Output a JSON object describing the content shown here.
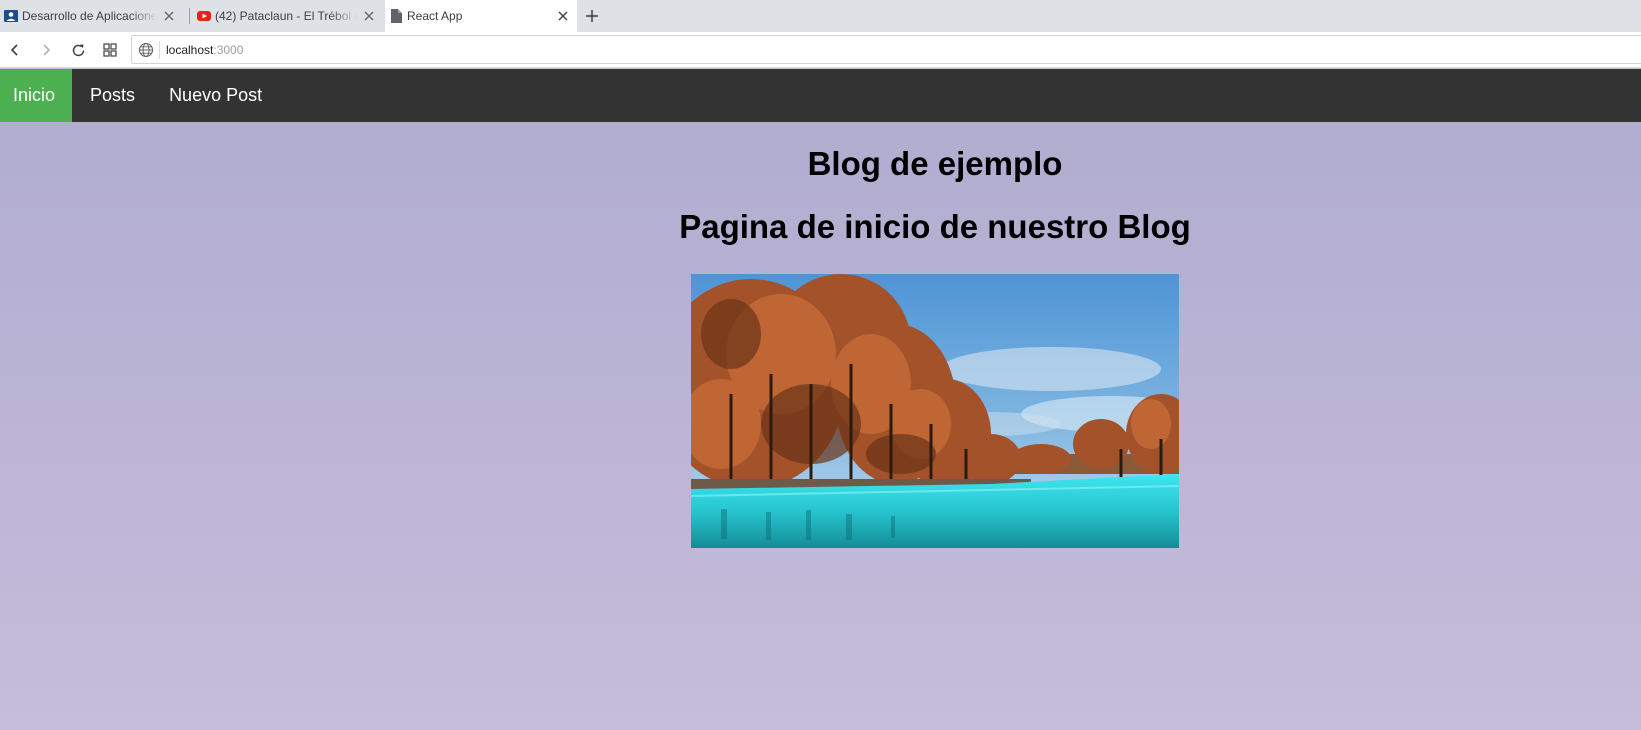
{
  "browser": {
    "tabs": [
      {
        "title": "Desarrollo de Aplicaciones",
        "icon": "contact-card-icon",
        "active": false
      },
      {
        "title": "(42) Pataclaun - El Trébol de",
        "icon": "youtube-icon",
        "active": false
      },
      {
        "title": "React App",
        "icon": "document-icon",
        "active": true
      }
    ],
    "address": {
      "host": "localhost",
      "port": ":3000"
    }
  },
  "nav": {
    "items": [
      {
        "label": "Inicio",
        "active": true
      },
      {
        "label": "Posts",
        "active": false
      },
      {
        "label": "Nuevo Post",
        "active": false
      }
    ],
    "active_color": "#4caf50",
    "bar_color": "#333333"
  },
  "main": {
    "title": "Blog de ejemplo",
    "subtitle": "Pagina de inicio de nuestro Blog",
    "image_subject": "autumn trees beside turquoise lake"
  }
}
